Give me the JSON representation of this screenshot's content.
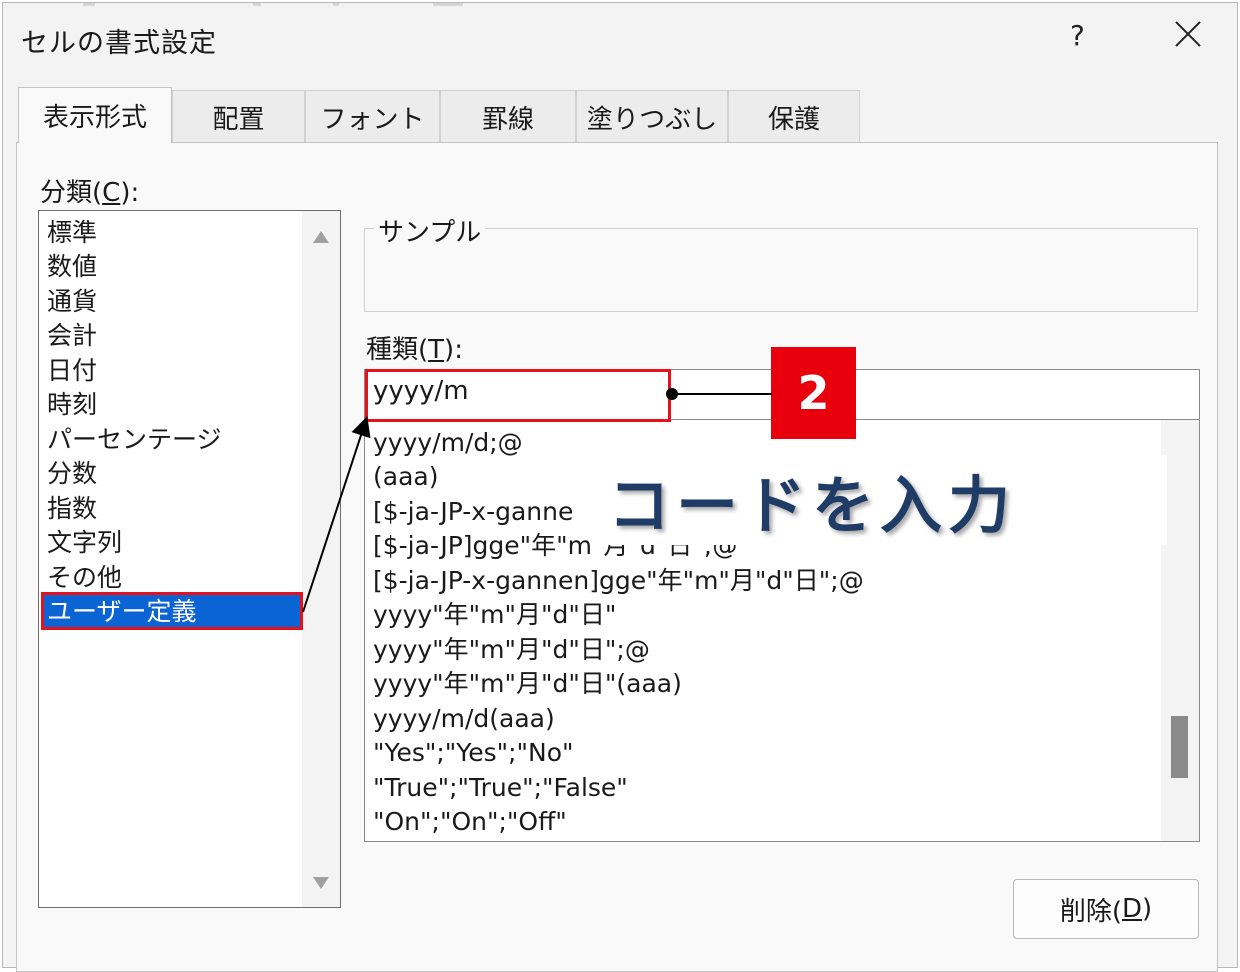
{
  "dialog": {
    "title": "セルの書式設定",
    "help_label": "?",
    "close_icon": "close-icon"
  },
  "tabs": [
    {
      "label": "表示形式",
      "active": true
    },
    {
      "label": "配置"
    },
    {
      "label": "フォント"
    },
    {
      "label": "罫線"
    },
    {
      "label": "塗りつぶし"
    },
    {
      "label": "保護"
    }
  ],
  "category": {
    "label_prefix": "分類(",
    "label_key": "C",
    "label_suffix": "):",
    "items": [
      "標準",
      "数値",
      "通貨",
      "会計",
      "日付",
      "時刻",
      "パーセンテージ",
      "分数",
      "指数",
      "文字列",
      "その他",
      "ユーザー定義"
    ],
    "selected_index": 11
  },
  "sample": {
    "label": "サンプル"
  },
  "type": {
    "label_prefix": "種類(",
    "label_key": "T",
    "label_suffix": "):",
    "value": "yyyy/m",
    "items": [
      "yyyy/m/d;@",
      "(aaa)",
      "[$-ja-JP-x-ganne",
      "[$-ja-JP]gge\"年\"m\"月\"d\"日\";@",
      "[$-ja-JP-x-gannen]gge\"年\"m\"月\"d\"日\";@",
      "yyyy\"年\"m\"月\"d\"日\"",
      "yyyy\"年\"m\"月\"d\"日\";@",
      "yyyy\"年\"m\"月\"d\"日\"(aaa)",
      "yyyy/m/d(aaa)",
      "\"Yes\";\"Yes\";\"No\"",
      "\"True\";\"True\";\"False\"",
      "\"On\";\"On\";\"Off\""
    ]
  },
  "buttons": {
    "delete_prefix": "削除(",
    "delete_key": "D",
    "delete_suffix": ")"
  },
  "annotation": {
    "step_number": "2",
    "callout_text": "コードを入力",
    "highlight_color": "#e8101a",
    "badge_color": "#e8000c",
    "callout_color": "#1f3c66"
  },
  "colors": {
    "selection": "#0a64d4",
    "dialog_bg": "#f3f3f3"
  }
}
